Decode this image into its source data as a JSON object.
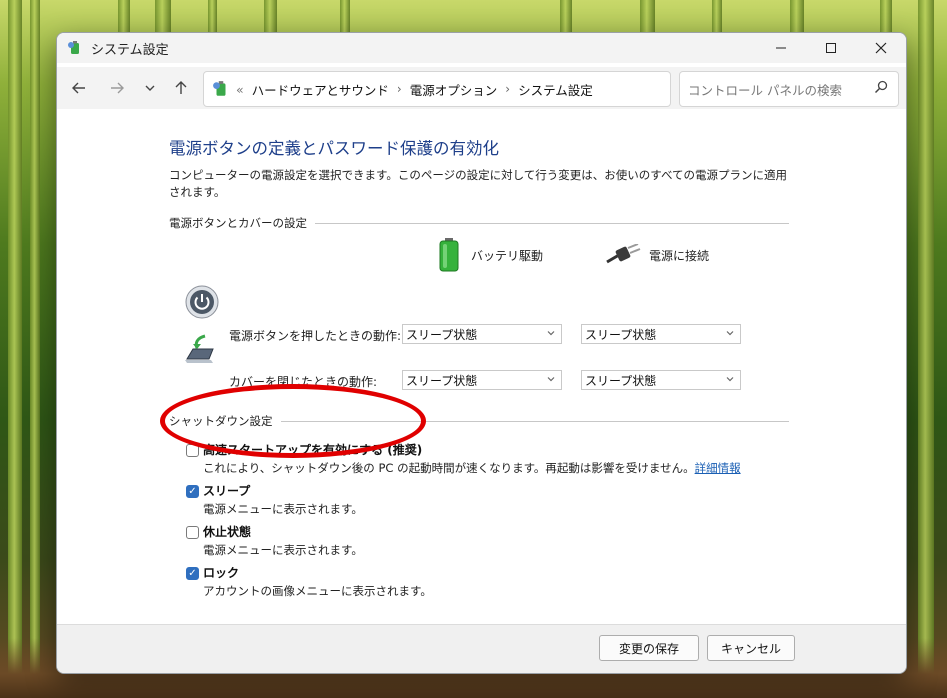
{
  "window": {
    "title": "システム設定"
  },
  "titlebar_buttons": [
    "minimize-icon",
    "maximize-icon",
    "close-icon"
  ],
  "nav": {
    "back_icon": "arrow-left-icon",
    "forward_icon": "arrow-right-icon",
    "recent_icon": "chevron-down-icon",
    "up_icon": "arrow-up-icon"
  },
  "address": {
    "overflow": "«",
    "breadcrumbs": [
      "ハードウェアとサウンド",
      "電源オプション",
      "システム設定"
    ],
    "separator": "›"
  },
  "search": {
    "placeholder": "コントロール パネルの検索"
  },
  "page": {
    "title": "電源ボタンの定義とパスワード保護の有効化",
    "description": "コンピューターの電源設定を選択できます。このページの設定に対して行う変更は、お使いのすべての電源プランに適用されます。"
  },
  "power_section": {
    "title": "電源ボタンとカバーの設定",
    "col_battery": "バッテリ駆動",
    "col_plugged": "電源に接続",
    "rows": [
      {
        "label": "電源ボタンを押したときの動作:",
        "battery": "スリープ状態",
        "plugged": "スリープ状態"
      },
      {
        "label": "カバーを閉じたときの動作:",
        "battery": "スリープ状態",
        "plugged": "スリープ状態"
      }
    ]
  },
  "shutdown_section": {
    "title": "シャットダウン設定",
    "options": [
      {
        "title": "高速スタートアップを有効にする (推奨)",
        "desc": "これにより、シャットダウン後の PC の起動時間が速くなります。再起動は影響を受けません。",
        "link": "詳細情報",
        "checked": false
      },
      {
        "title": "スリープ",
        "desc": "電源メニューに表示されます。",
        "checked": true
      },
      {
        "title": "休止状態",
        "desc": "電源メニューに表示されます。",
        "checked": false
      },
      {
        "title": "ロック",
        "desc": "アカウントの画像メニューに表示されます。",
        "checked": true
      }
    ]
  },
  "footer": {
    "save": "変更の保存",
    "cancel": "キャンセル"
  },
  "colors": {
    "title_blue": "#1e3f8a",
    "checkbox_blue": "#2f6fbf",
    "annotation_red": "#e00000"
  }
}
